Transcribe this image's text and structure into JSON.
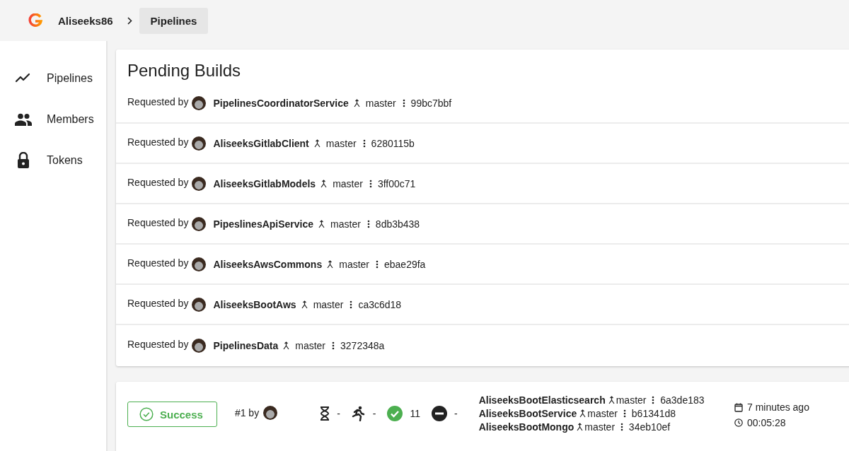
{
  "breadcrumb": {
    "org": "Aliseeks86",
    "page": "Pipelines"
  },
  "sidebar": {
    "items": [
      {
        "label": "Pipelines",
        "kind": "chart"
      },
      {
        "label": "Members",
        "kind": "people"
      },
      {
        "label": "Tokens",
        "kind": "lock"
      }
    ]
  },
  "pending_builds": {
    "title": "Pending Builds",
    "requests": [
      {
        "prefix": "Requested by",
        "project": "PipelinesCoordinatorService",
        "branch": "master",
        "commit": "99bc7bbf"
      },
      {
        "prefix": "Requested by",
        "project": "AliseeksGitlabClient",
        "branch": "master",
        "commit": "6280115b"
      },
      {
        "prefix": "Requested by",
        "project": "AliseeksGitlabModels",
        "branch": "master",
        "commit": "3ff00c71"
      },
      {
        "prefix": "Requested by",
        "project": "PipeslinesApiService",
        "branch": "master",
        "commit": "8db3b438"
      },
      {
        "prefix": "Requested by",
        "project": "AliseeksAwsCommons",
        "branch": "master",
        "commit": "ebae29fa"
      },
      {
        "prefix": "Requested by",
        "project": "AliseeksBootAws",
        "branch": "master",
        "commit": "ca3c6d18"
      },
      {
        "prefix": "Requested by",
        "project": "PipelinesData",
        "branch": "master",
        "commit": "3272348a"
      }
    ]
  },
  "builds": [
    {
      "kind": "success",
      "status_label": "Success",
      "number": "#1 by",
      "stats": [
        {
          "kind": "pending",
          "value": "-"
        },
        {
          "kind": "running",
          "value": "-"
        },
        {
          "kind": "passed",
          "value": "11"
        },
        {
          "kind": "skipped",
          "value": "-"
        }
      ],
      "projects": [
        {
          "project": "AliseeksBootElasticsearch",
          "branch": "master",
          "commit": "6a3de183"
        },
        {
          "project": "AliseeksBootService",
          "branch": "master",
          "commit": "b61341d8"
        },
        {
          "project": "AliseeksBootMongo",
          "branch": "master",
          "commit": "34eb10ef"
        }
      ],
      "created": "7 minutes ago",
      "duration": "00:05:28"
    }
  ]
}
